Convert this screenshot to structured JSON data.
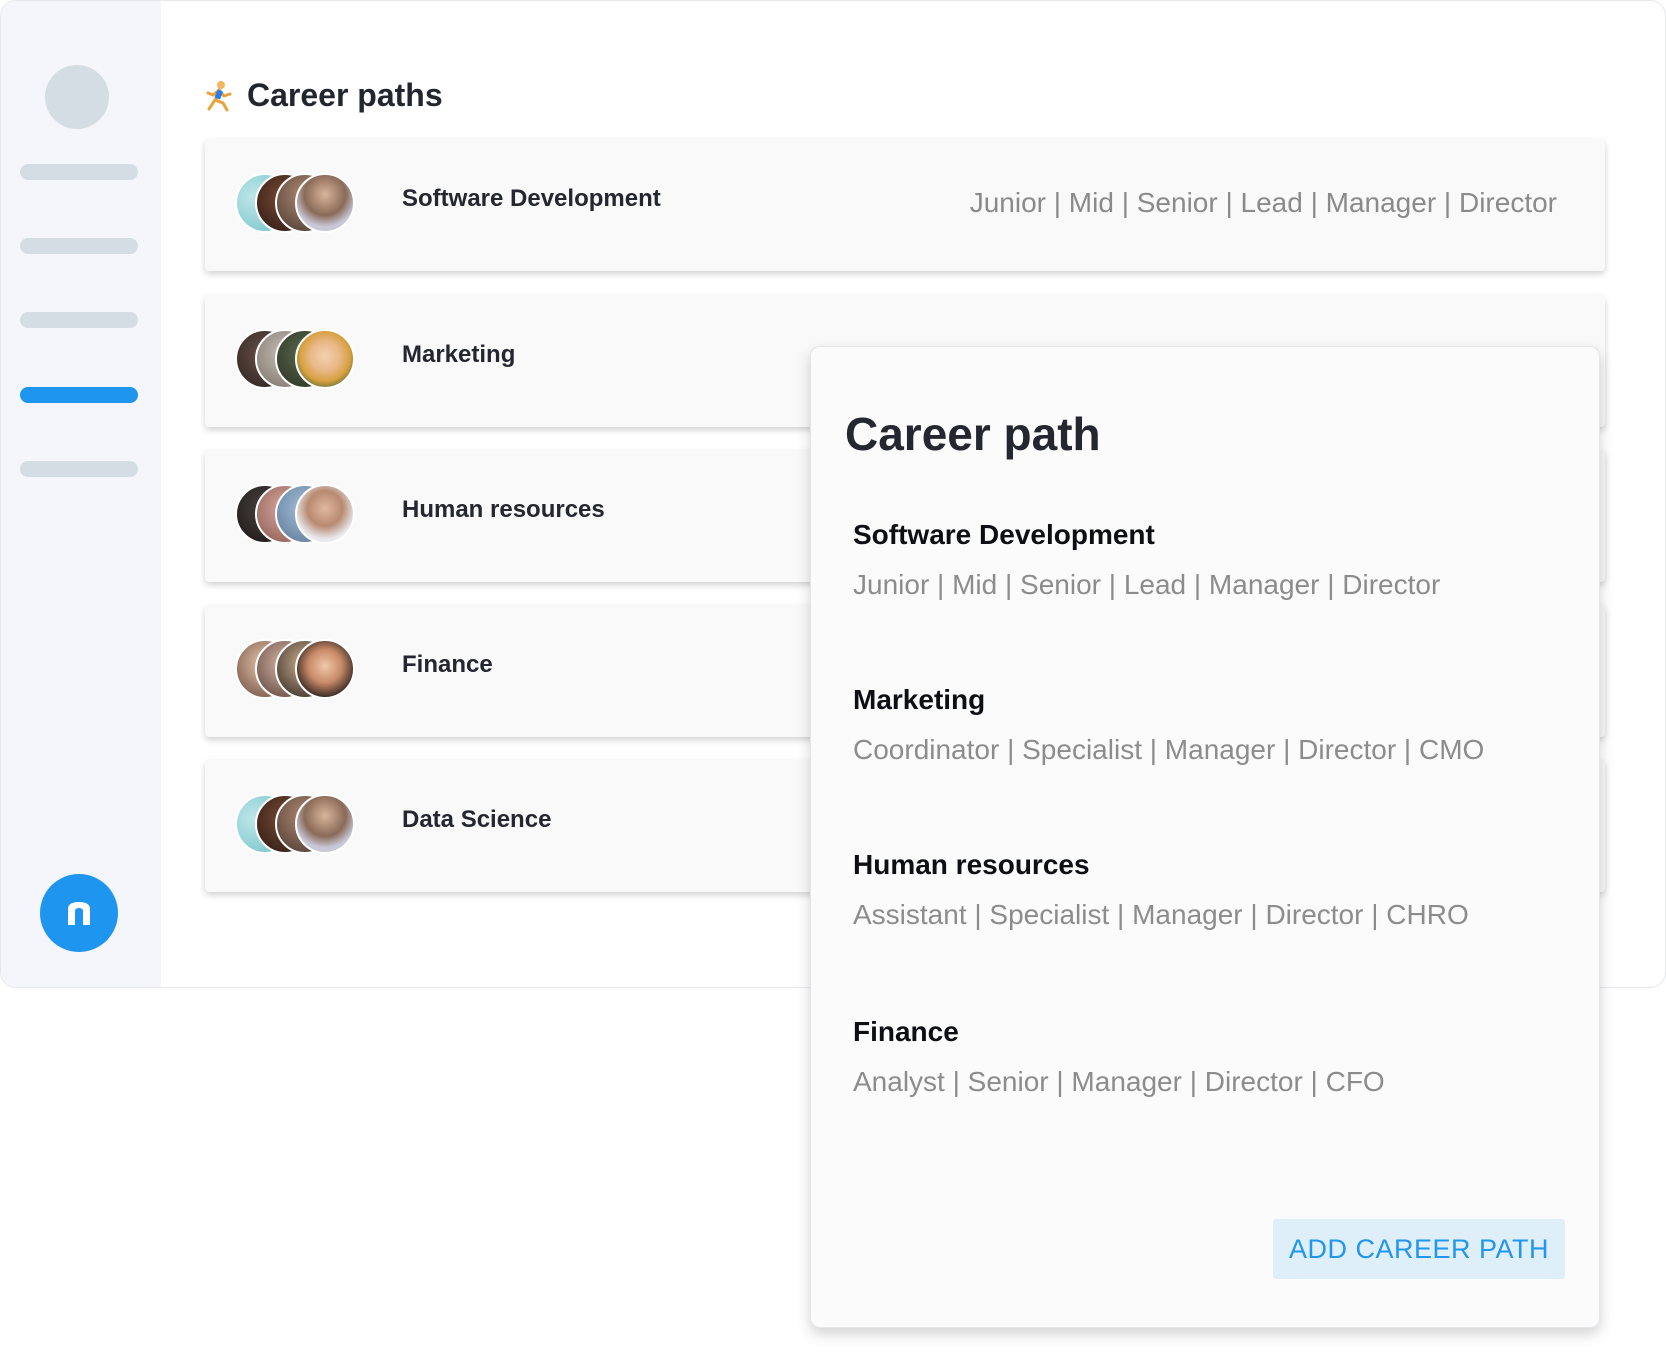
{
  "page": {
    "title": "Career paths",
    "title_icon": "running-person-icon"
  },
  "sidebar": {
    "avatar_icon": "avatar-placeholder",
    "items": [
      "menu-line",
      "menu-line",
      "menu-line",
      "menu-line-active",
      "menu-line"
    ],
    "logo_letter": "n"
  },
  "rows": [
    {
      "title": "Software Development",
      "levels": "Junior | Mid | Senior | Lead | Manager | Director"
    },
    {
      "title": "Marketing"
    },
    {
      "title": "Human resources"
    },
    {
      "title": "Finance"
    },
    {
      "title": "Data Science"
    }
  ],
  "panel": {
    "title": "Career path",
    "paths": [
      {
        "name": "Software Development",
        "levels": "Junior | Mid | Senior | Lead | Manager | Director"
      },
      {
        "name": "Marketing",
        "levels": "Coordinator | Specialist | Manager | Director | CMO"
      },
      {
        "name": "Human resources",
        "levels": "Assistant | Specialist | Manager | Director | CHRO"
      },
      {
        "name": "Finance",
        "levels": "Analyst | Senior | Manager | Director | CFO"
      }
    ],
    "add_button": "ADD CAREER PATH"
  },
  "colors": {
    "accent": "#1e95ee",
    "sidebar_bg": "#f4f6fb",
    "placeholder": "#d4dde3",
    "button_bg": "#deeff9"
  }
}
